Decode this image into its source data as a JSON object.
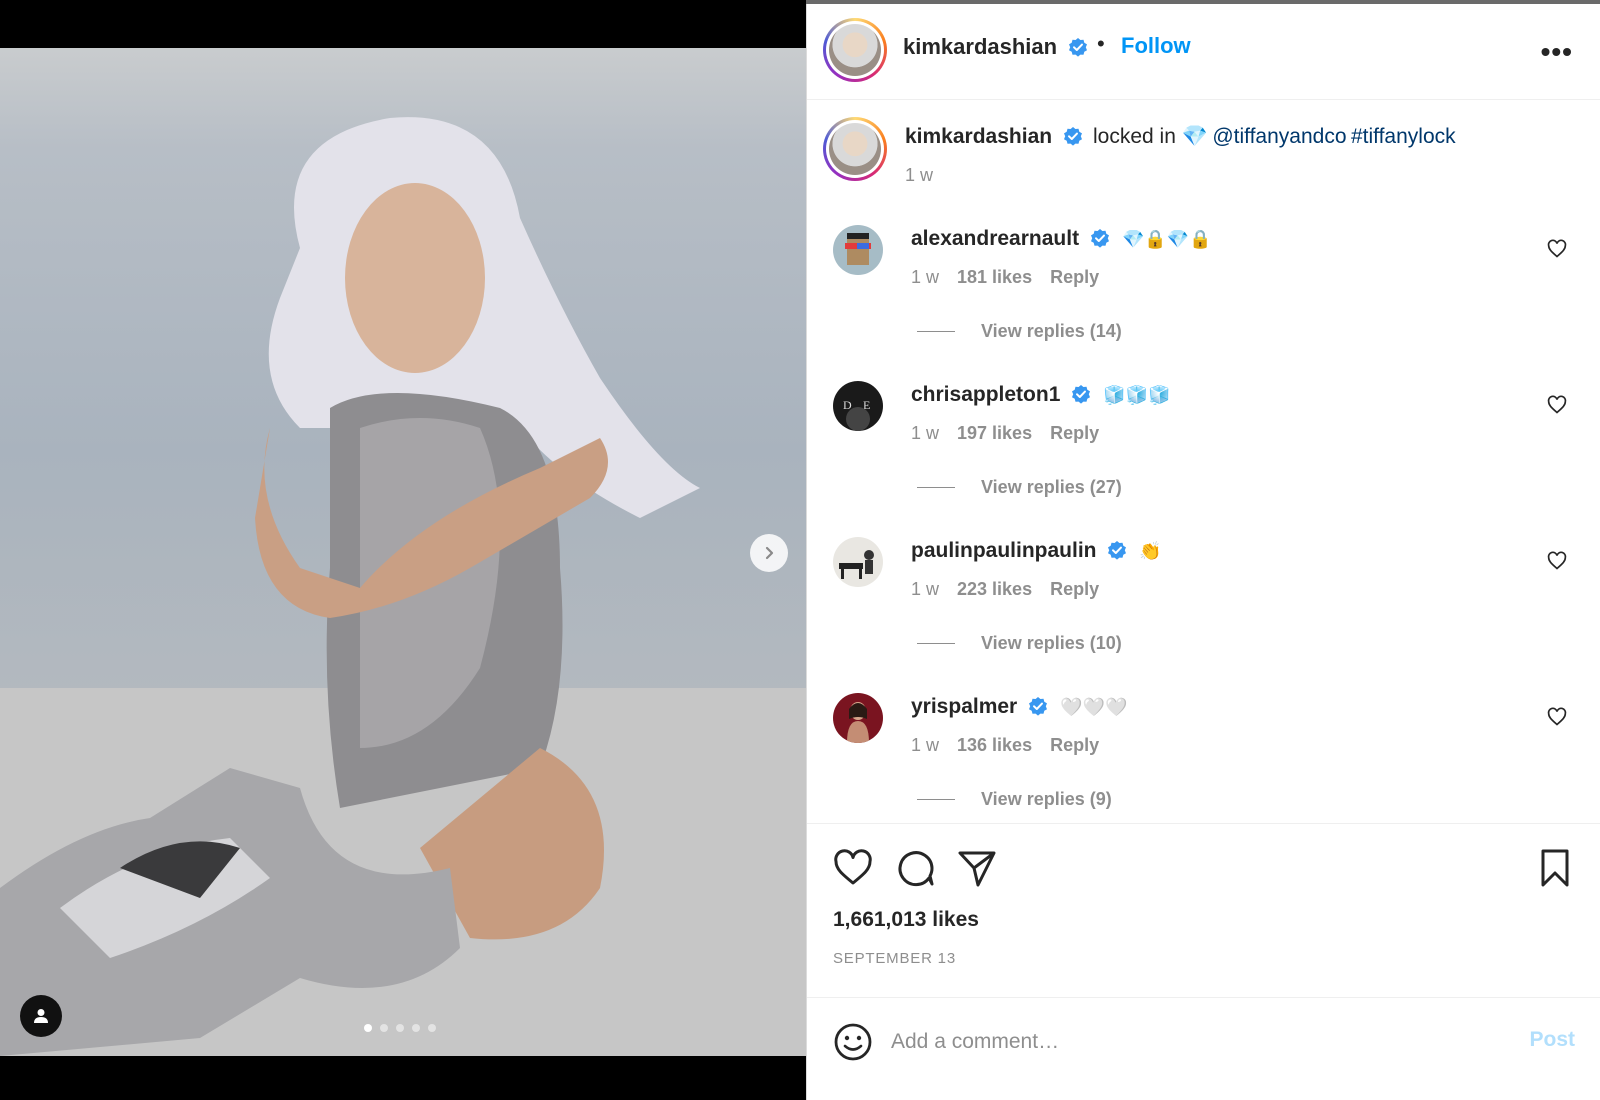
{
  "post": {
    "media": {
      "carousel_count": 5,
      "active_index": 0,
      "next_icon": "chevron-right-icon",
      "tag_icon": "user-tag-icon"
    },
    "author": {
      "username": "kimkardashian",
      "verified": true,
      "follow_label": "Follow",
      "separator": "•",
      "more_label": "•••"
    },
    "caption": {
      "username": "kimkardashian",
      "text": "locked in 💎",
      "mention": "@tiffanyandco",
      "hashtag": "#tiffanylock",
      "time": "1 w"
    },
    "comments": [
      {
        "username": "alexandrearnault",
        "text": "💎🔒💎🔒",
        "time": "1 w",
        "likes": "181 likes",
        "reply": "Reply",
        "view_replies": "View replies (14)"
      },
      {
        "username": "chrisappleton1",
        "text": "🧊🧊🧊",
        "time": "1 w",
        "likes": "197 likes",
        "reply": "Reply",
        "view_replies": "View replies (27)"
      },
      {
        "username": "paulinpaulinpaulin",
        "text": "👏",
        "time": "1 w",
        "likes": "223 likes",
        "reply": "Reply",
        "view_replies": "View replies (10)"
      },
      {
        "username": "yrispalmer",
        "text": "🤍🤍🤍",
        "time": "1 w",
        "likes": "136 likes",
        "reply": "Reply",
        "view_replies": "View replies (9)"
      }
    ],
    "actions": {
      "like_icon": "heart-icon",
      "comment_icon": "comment-bubble-icon",
      "share_icon": "paper-plane-icon",
      "save_icon": "bookmark-icon"
    },
    "likes": "1,661,013 likes",
    "date": "SEPTEMBER 13",
    "add_comment": {
      "placeholder": "Add a comment…",
      "post_label": "Post",
      "emoji_icon": "smile-icon"
    },
    "colors": {
      "link_blue": "#0095f6",
      "mention_blue": "#00376b",
      "muted": "#8e8e8e",
      "post_disabled": "#b2dffc",
      "verified": "#3897f0"
    }
  }
}
